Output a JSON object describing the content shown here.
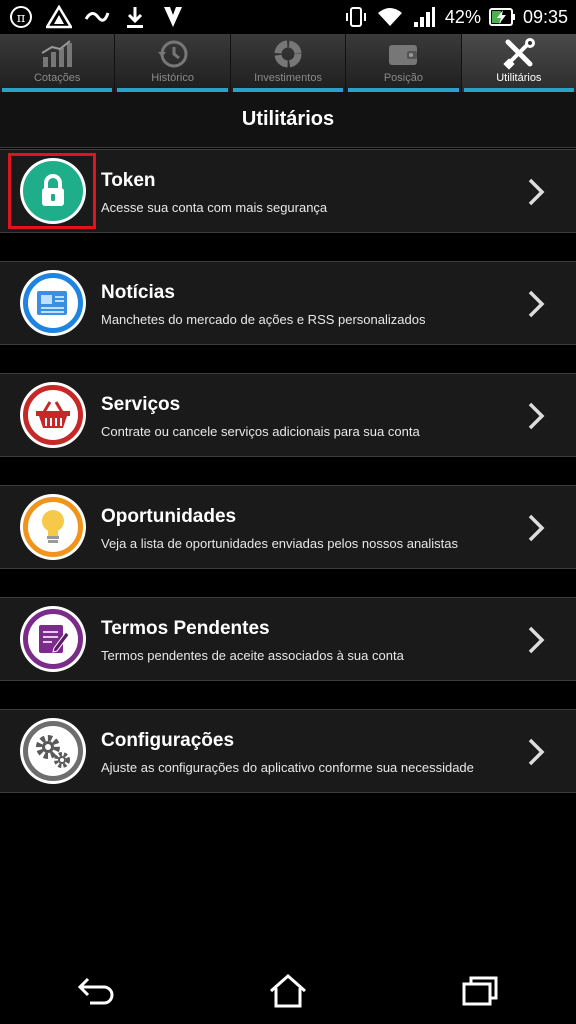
{
  "status_bar": {
    "battery_percent": "42%",
    "time": "09:35"
  },
  "tabs": [
    {
      "label": "Cotações",
      "icon": "chart-icon"
    },
    {
      "label": "Histórico",
      "icon": "history-icon"
    },
    {
      "label": "Investimentos",
      "icon": "donut-icon"
    },
    {
      "label": "Posição",
      "icon": "wallet-icon"
    },
    {
      "label": "Utilitários",
      "icon": "tools-icon",
      "active": true
    }
  ],
  "page": {
    "title": "Utilitários"
  },
  "items": [
    {
      "title": "Token",
      "subtitle": "Acesse sua conta com mais segurança",
      "icon": "lock-icon",
      "color": "#1fae8a"
    },
    {
      "title": "Notícias",
      "subtitle": "Manchetes do mercado de ações e RSS personalizados",
      "icon": "newspaper-icon",
      "color": "#1e84e0"
    },
    {
      "title": "Serviços",
      "subtitle": "Contrate ou cancele serviços adicionais para sua conta",
      "icon": "basket-icon",
      "color": "#c62828"
    },
    {
      "title": "Oportunidades",
      "subtitle": "Veja a lista de oportunidades enviadas pelos nossos analistas",
      "icon": "lightbulb-icon",
      "color": "#f0941c"
    },
    {
      "title": "Termos Pendentes",
      "subtitle": "Termos pendentes de aceite associados à sua conta",
      "icon": "document-edit-icon",
      "color": "#7b2c8a"
    },
    {
      "title": "Configurações",
      "subtitle": "Ajuste as configurações do aplicativo conforme sua necessidade",
      "icon": "gears-icon",
      "color": "#6e6e6e"
    }
  ],
  "colors": {
    "accent": "#2aa1c8",
    "highlight": "#e0141e"
  }
}
